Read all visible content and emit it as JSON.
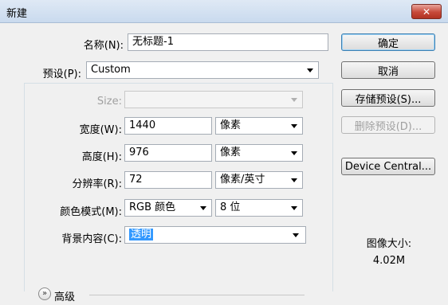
{
  "window": {
    "title": "新建",
    "close_label": "✕"
  },
  "form": {
    "name_label": "名称(N):",
    "name_value": "无标题-1",
    "preset_label": "预设(P):",
    "preset_value": "Custom",
    "size_label": "Size:",
    "size_value": "",
    "width_label": "宽度(W):",
    "width_value": "1440",
    "width_unit": "像素",
    "height_label": "高度(H):",
    "height_value": "976",
    "height_unit": "像素",
    "resolution_label": "分辨率(R):",
    "resolution_value": "72",
    "resolution_unit": "像素/英寸",
    "colormode_label": "颜色模式(M):",
    "colormode_value": "RGB 颜色",
    "bitdepth_value": "8 位",
    "background_label": "背景内容(C):",
    "background_value": "透明",
    "advanced_label": "高级",
    "advanced_icon": "double-chevron-down-icon"
  },
  "buttons": {
    "ok": "确定",
    "cancel": "取消",
    "save_preset": "存储预设(S)...",
    "delete_preset": "删除预设(D)...",
    "device_central": "Device Central..."
  },
  "image_size": {
    "label": "图像大小:",
    "value": "4.02M"
  }
}
